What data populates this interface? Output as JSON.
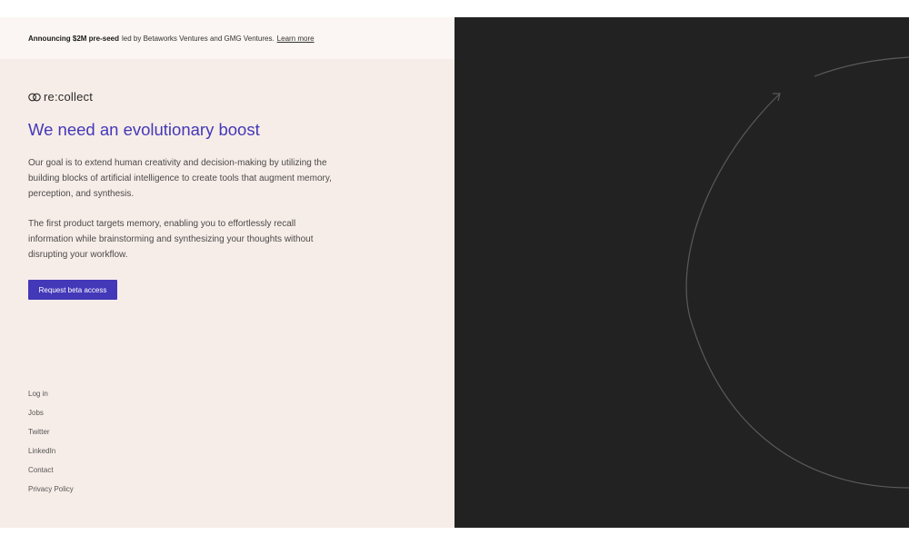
{
  "announcement": {
    "bold": "Announcing $2M pre-seed",
    "text": "led by Betaworks Ventures and GMG Ventures.",
    "link": "Learn more"
  },
  "brand": {
    "name": "re:collect",
    "icon": "interlocking-rings-icon"
  },
  "hero": {
    "title": "We need an evolutionary boost",
    "paragraph_1": "Our goal is to extend human creativity and decision-making by utilizing the building blocks of artificial intelligence to create tools that augment memory, perception, and synthesis.",
    "paragraph_2": "The first product targets memory, enabling you to effortlessly recall information while brainstorming and synthesizing your thoughts without disrupting your workflow.",
    "cta": "Request beta access"
  },
  "footer_links": [
    "Log in",
    "Jobs",
    "Twitter",
    "LinkedIn",
    "Contact",
    "Privacy Policy"
  ],
  "colors": {
    "accent": "#4338b8",
    "left_background": "#f7ede8",
    "banner_background": "#fbf6f3",
    "right_background": "#222222",
    "arc_stroke": "#5a5a5a"
  }
}
